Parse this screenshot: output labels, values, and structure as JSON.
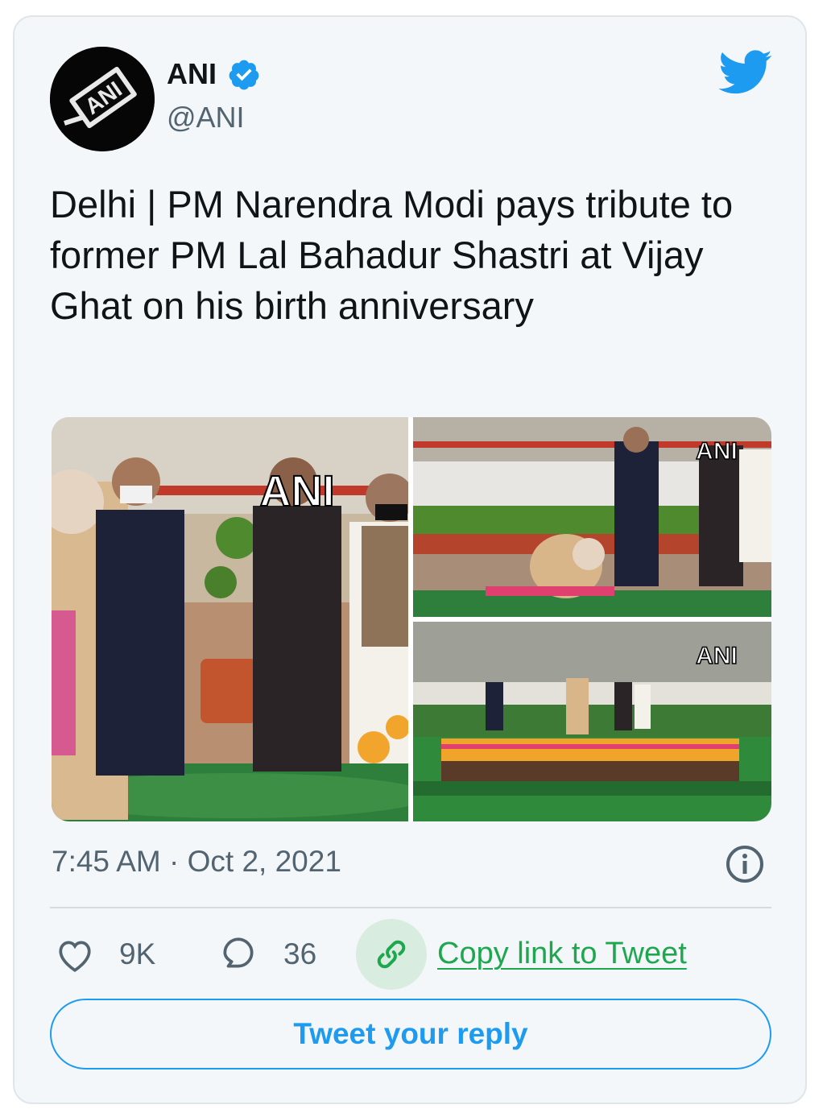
{
  "tweet": {
    "author": {
      "name": "ANI",
      "handle": "@ANI",
      "verified": true,
      "avatar_logo_text": "ANI"
    },
    "text": "Delhi | PM Narendra Modi pays tribute to former PM Lal Bahadur Shastri at Vijay Ghat on his birth anniversary",
    "media": [
      {
        "watermark": "ANI",
        "content": "photo-tribute-flowers"
      },
      {
        "watermark": "ANI",
        "content": "photo-bowing"
      },
      {
        "watermark": "ANI",
        "content": "photo-memorial-wide"
      }
    ],
    "timestamp": "7:45 AM · Oct 2, 2021",
    "actions": {
      "likes": "9K",
      "replies": "36",
      "copy_link_label": "Copy link to Tweet"
    },
    "reply_button_label": "Tweet your reply"
  },
  "icons": {
    "bird": "twitter-bird-icon",
    "verified": "verified-badge-icon",
    "info": "info-icon",
    "like": "heart-icon",
    "reply": "reply-bubble-icon",
    "link": "link-icon"
  },
  "colors": {
    "twitter_blue": "#1d9bf0",
    "copy_green": "#1fa750",
    "text_primary": "#0f1419",
    "text_secondary": "#536471",
    "card_background": "#f4f7f9"
  }
}
